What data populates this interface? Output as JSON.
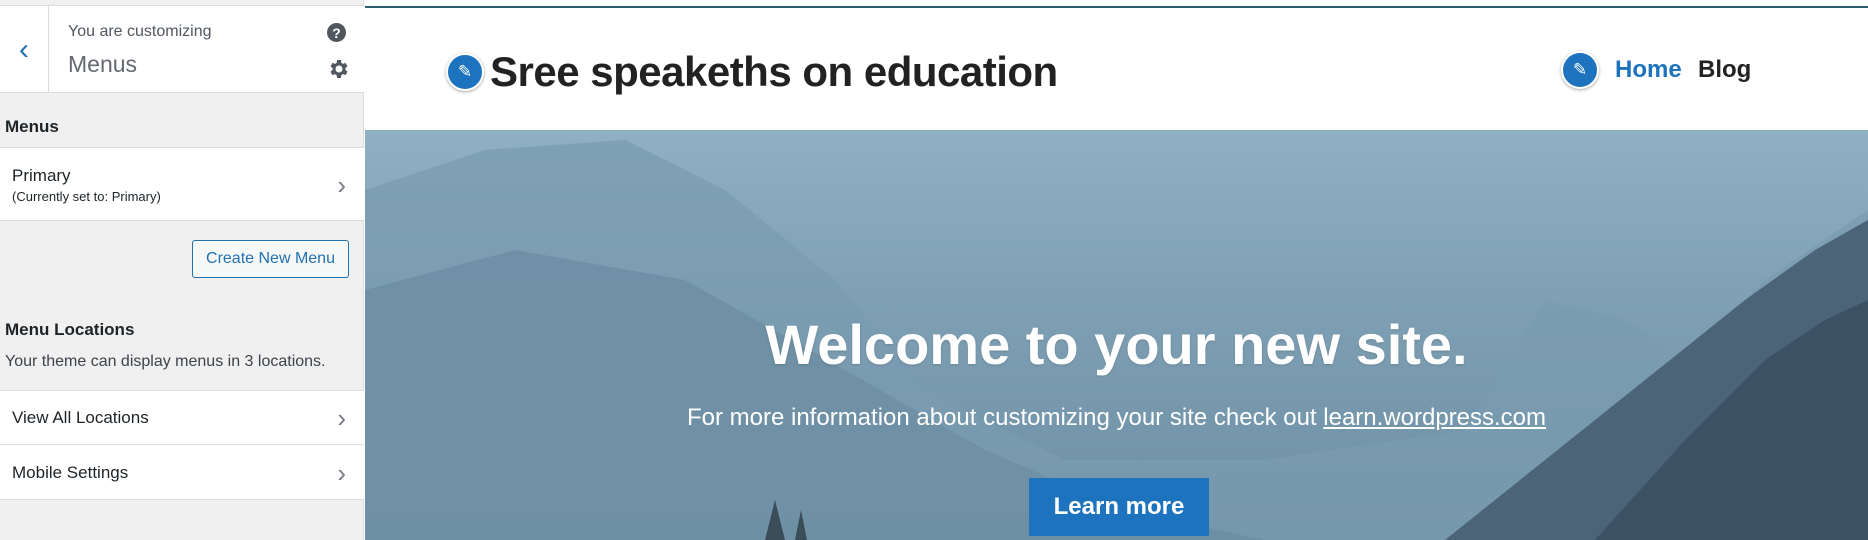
{
  "sidebar": {
    "customizing_label": "You are customizing",
    "title": "Menus",
    "menus_section": "Menus",
    "primary": {
      "label": "Primary",
      "sub": "(Currently set to: Primary)"
    },
    "create_button": "Create New Menu",
    "locations_section": "Menu Locations",
    "locations_desc": "Your theme can display menus in 3 locations.",
    "view_all": "View All Locations",
    "mobile": "Mobile Settings"
  },
  "preview": {
    "site_title": "Sree speakeths on education",
    "nav": {
      "home": "Home",
      "blog": "Blog"
    },
    "hero": {
      "title": "Welcome to your new site.",
      "sub_text": "For more information about customizing your site check out ",
      "sub_link": "learn.wordpress.com",
      "button": "Learn more"
    }
  },
  "colors": {
    "accent": "#1e73be",
    "wp_blue": "#2271b1"
  }
}
